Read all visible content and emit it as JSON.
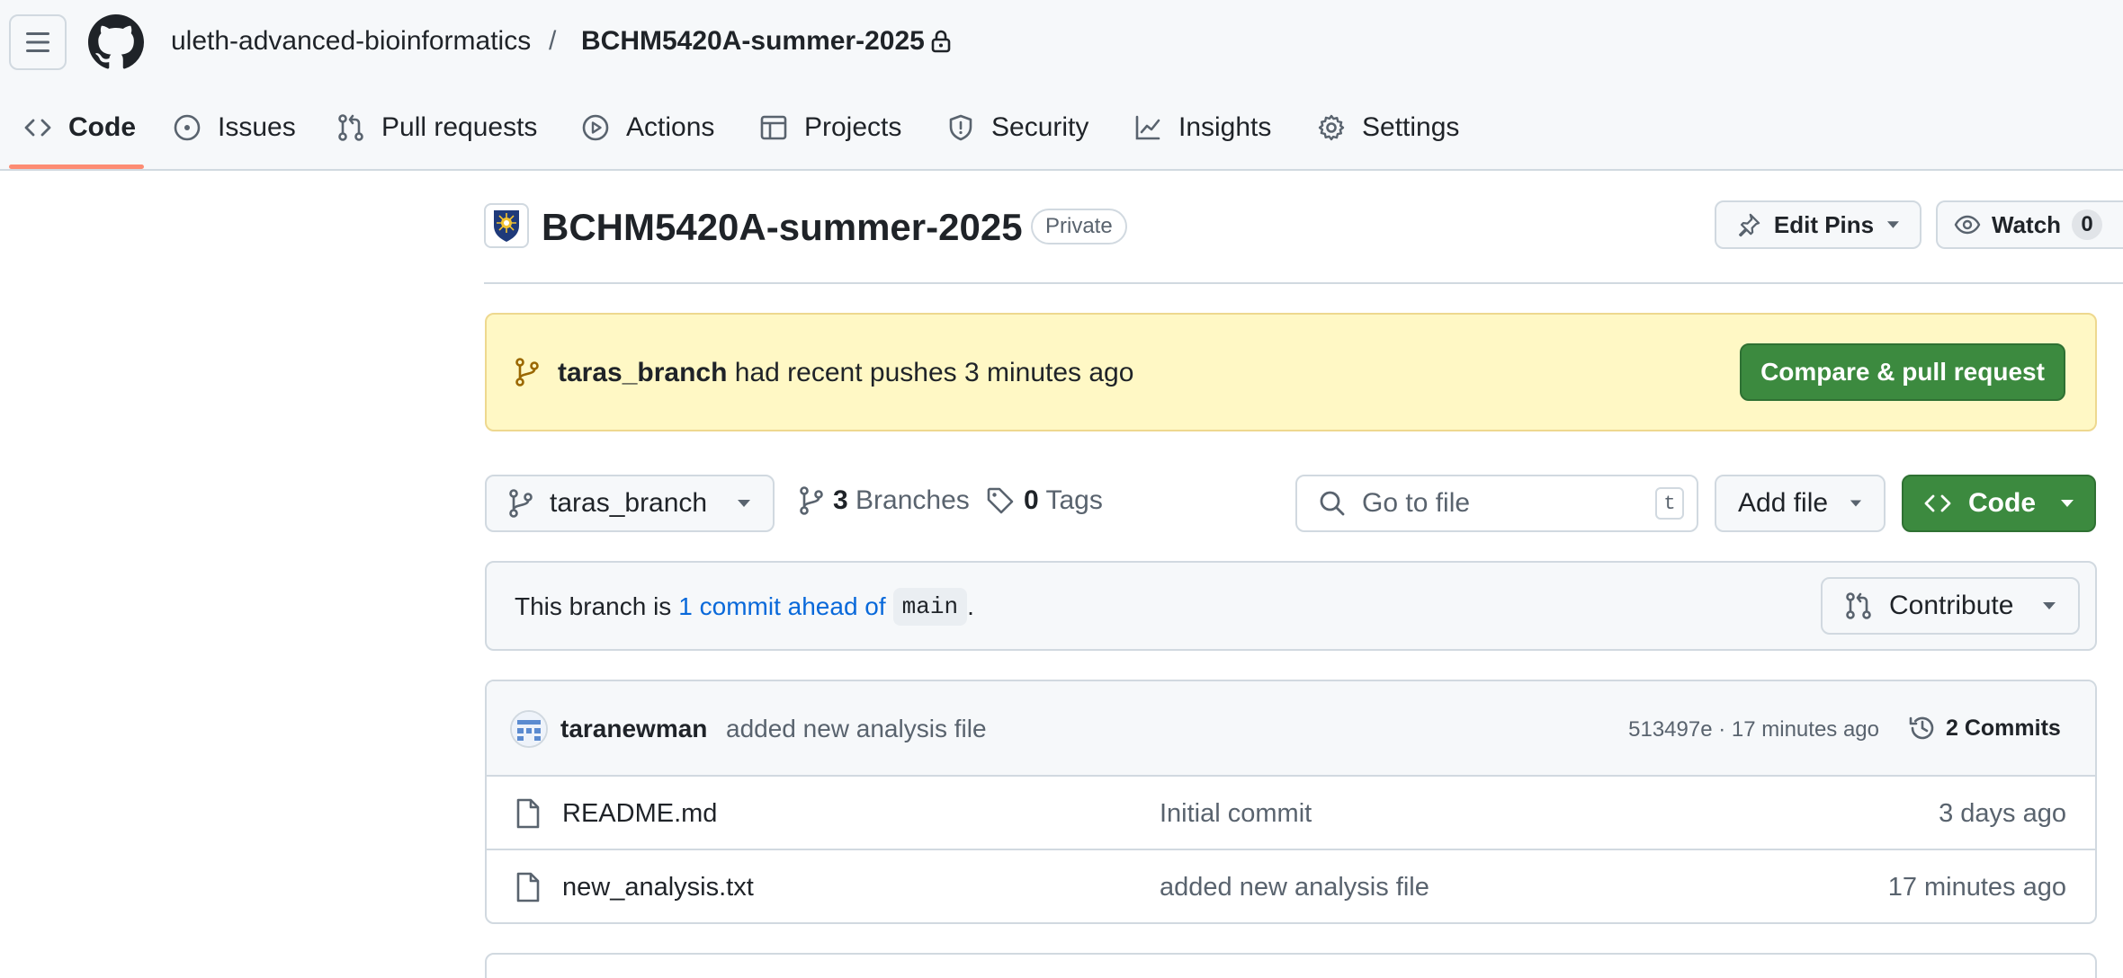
{
  "header": {
    "owner": "uleth-advanced-bioinformatics",
    "separator": "/",
    "repo": "BCHM5420A-summer-2025"
  },
  "nav": {
    "tabs": [
      {
        "label": "Code",
        "icon": "code-icon",
        "selected": true
      },
      {
        "label": "Issues",
        "icon": "issue-icon"
      },
      {
        "label": "Pull requests",
        "icon": "pull-request-icon"
      },
      {
        "label": "Actions",
        "icon": "play-icon"
      },
      {
        "label": "Projects",
        "icon": "table-icon"
      },
      {
        "label": "Security",
        "icon": "shield-icon"
      },
      {
        "label": "Insights",
        "icon": "graph-icon"
      },
      {
        "label": "Settings",
        "icon": "gear-icon"
      }
    ]
  },
  "repo": {
    "title": "BCHM5420A-summer-2025",
    "visibility": "Private",
    "edit_pins": "Edit Pins",
    "watch_label": "Watch",
    "watch_count": "0"
  },
  "banner": {
    "branch": "taras_branch",
    "text": "had recent pushes 3 minutes ago",
    "button": "Compare & pull request"
  },
  "toolbar": {
    "branch": "taras_branch",
    "branches_count": "3",
    "branches_label": "Branches",
    "tags_count": "0",
    "tags_label": "Tags",
    "search_placeholder": "Go to file",
    "search_shortcut": "t",
    "add_file": "Add file",
    "code_button": "Code"
  },
  "branch_status": {
    "prefix": "This branch is",
    "link": "1 commit ahead of",
    "base": "main",
    "suffix": ".",
    "contribute": "Contribute"
  },
  "latest_commit": {
    "author": "taranewman",
    "message": "added new analysis file",
    "meta": "513497e · 17 minutes ago",
    "commits_label": "2 Commits"
  },
  "files": [
    {
      "name": "README.md",
      "message": "Initial commit",
      "time": "3 days ago"
    },
    {
      "name": "new_analysis.txt",
      "message": "added new analysis file",
      "time": "17 minutes ago"
    }
  ],
  "colors": {
    "accent_green": "#3c8a3f",
    "banner_bg": "#fff8c5",
    "link_blue": "#0969da",
    "tab_underline": "#fd8c73"
  }
}
